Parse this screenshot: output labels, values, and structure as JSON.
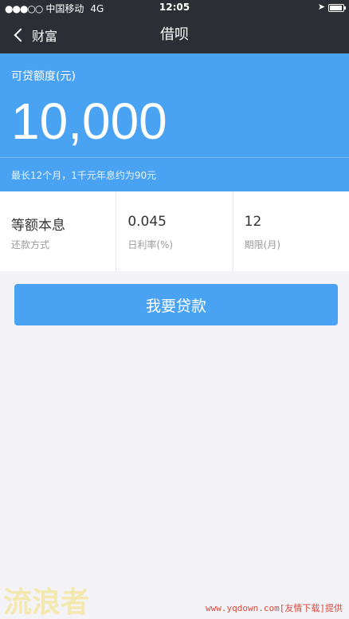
{
  "status_bar": {
    "signal": "●●●○○",
    "carrier": "中国移动",
    "network": "4G",
    "time": "12:05",
    "location_icon": "location-arrow-icon",
    "battery_icon": "battery-icon"
  },
  "nav": {
    "back_label": "财富",
    "title": "借呗"
  },
  "hero": {
    "label": "可贷额度(元)",
    "amount": "10,000",
    "note": "最长12个月，1千元年息约为90元"
  },
  "info": {
    "items": [
      {
        "value": "等额本息",
        "caption": "还款方式"
      },
      {
        "value": "0.045",
        "caption": "日利率(%)"
      },
      {
        "value": "12",
        "caption": "期限(月)"
      }
    ]
  },
  "actions": {
    "apply_label": "我要贷款"
  },
  "watermark": {
    "logo_text": "流浪者",
    "site_text": "www.yqdown.com[友情下载]提供"
  },
  "colors": {
    "nav_bg": "#2b2e35",
    "accent": "#4aa3f2",
    "page_bg": "#f3f3f8"
  }
}
